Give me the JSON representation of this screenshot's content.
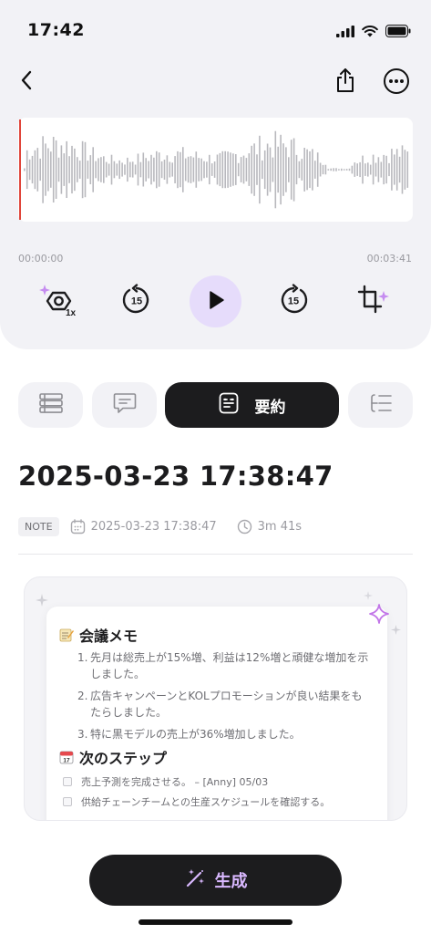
{
  "status_bar": {
    "time": "17:42",
    "icons": [
      "signal-icon",
      "wifi-icon",
      "battery-icon"
    ]
  },
  "nav": {
    "back_icon": "chevron-left-icon",
    "share_icon": "share-icon",
    "more_icon": "more-horizontal-icon"
  },
  "player": {
    "time_start": "00:00:00",
    "time_end": "00:03:41",
    "progress": 0,
    "speed_label": "1x",
    "rewind_label": "15",
    "forward_label": "15",
    "accent_color": "#e0453a",
    "play_bg_color": "#e6dcfb"
  },
  "tabs": [
    {
      "icon": "list-icon",
      "label": ""
    },
    {
      "icon": "chat-icon",
      "label": ""
    },
    {
      "icon": "summary-icon",
      "label": "要約",
      "active": true
    },
    {
      "icon": "outline-icon",
      "label": ""
    }
  ],
  "recording": {
    "title": "2025-03-23 17:38:47",
    "badge": "NOTE",
    "date": "2025-03-23 17:38:47",
    "duration": "3m 41s"
  },
  "summary_preview": {
    "section1_title": "会議メモ",
    "items": [
      {
        "num": "1.",
        "text": "先月は総売上が15%増、利益は12%増と頑健な増加を示しました。"
      },
      {
        "num": "2.",
        "text": "広告キャンペーンとKOLプロモーションが良い結果をもたらしました。"
      },
      {
        "num": "3.",
        "text": "特に黒モデルの売上が36%増加しました。"
      }
    ],
    "section2_title": "次のステップ",
    "tasks": [
      "売上予測を完成させる。 – [Anny] 05/03",
      "供給チェーンチームとの生産スケジュールを確認する。"
    ]
  },
  "generate_button": {
    "label": "生成",
    "label_color": "#d9b8ff"
  }
}
